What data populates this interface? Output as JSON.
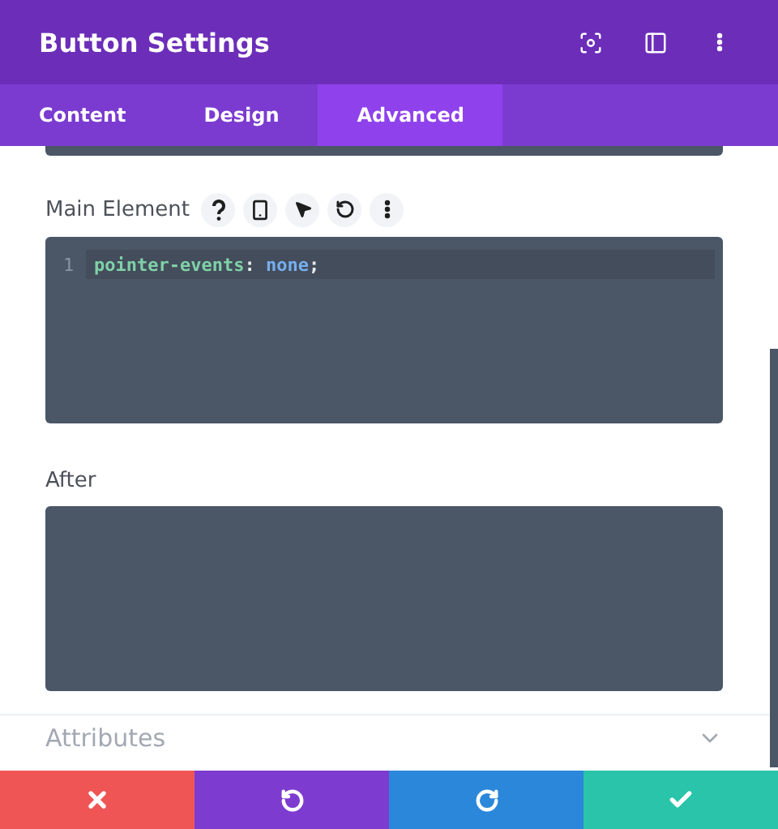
{
  "header": {
    "title": "Button Settings"
  },
  "tabs": [
    {
      "label": "Content",
      "selected": false
    },
    {
      "label": "Design",
      "selected": false
    },
    {
      "label": "Advanced",
      "selected": true
    }
  ],
  "fields": [
    {
      "label": "Main Element",
      "kind": "code",
      "lines": [
        {
          "number": "1",
          "tokens": [
            {
              "kind": "property",
              "text": "pointer-events"
            },
            {
              "kind": "punct",
              "text": ": "
            },
            {
              "kind": "value",
              "text": "none"
            },
            {
              "kind": "punct",
              "text": ";"
            }
          ]
        }
      ]
    },
    {
      "label": "After",
      "kind": "plain"
    }
  ],
  "section": {
    "title": "Attributes",
    "expanded": false
  }
}
